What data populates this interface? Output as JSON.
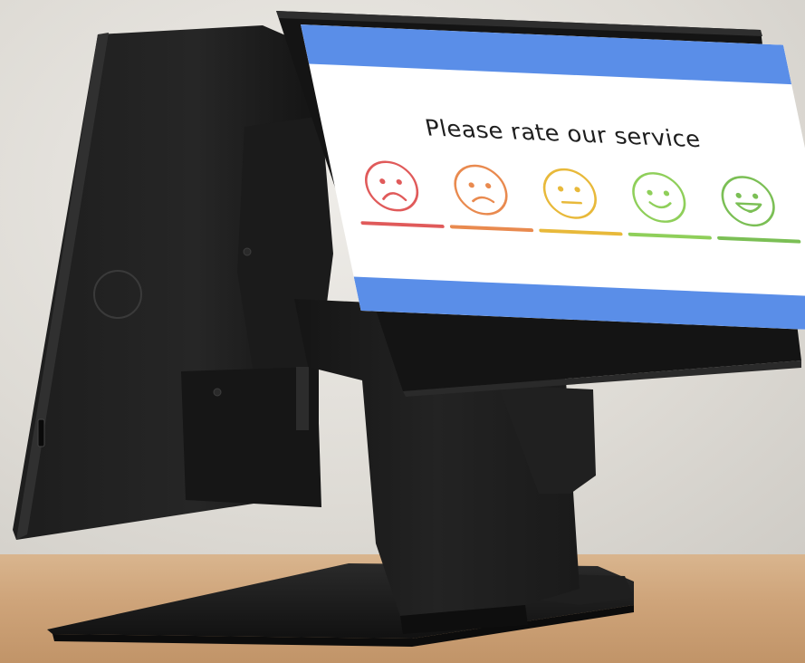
{
  "screen": {
    "prompt": "Please rate our service",
    "band_color": "#5a8ee8",
    "background": "#ffffff"
  },
  "ratings": [
    {
      "icon": "very-sad-face-icon",
      "color": "#e05a5a"
    },
    {
      "icon": "sad-face-icon",
      "color": "#e98a4f"
    },
    {
      "icon": "neutral-face-icon",
      "color": "#e8b93a"
    },
    {
      "icon": "smile-face-icon",
      "color": "#8fcf5a"
    },
    {
      "icon": "happy-face-icon",
      "color": "#7bbf55"
    }
  ]
}
